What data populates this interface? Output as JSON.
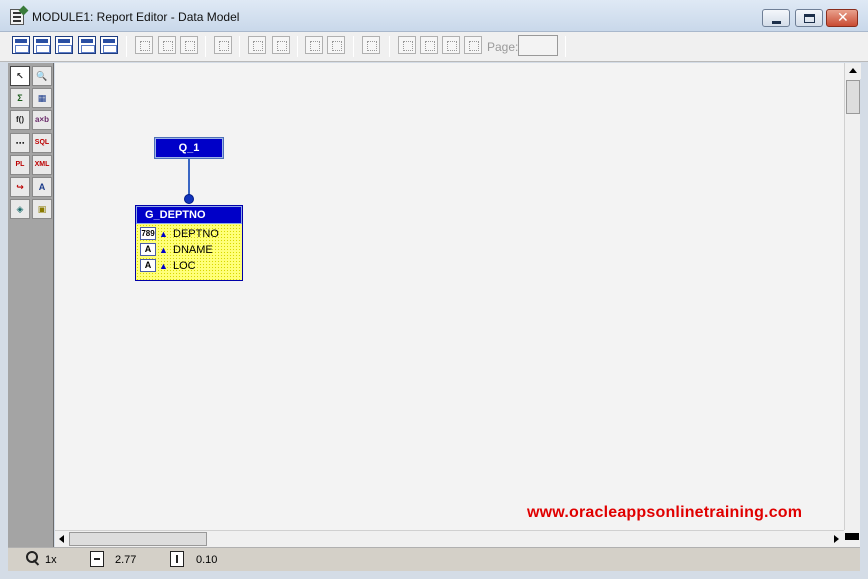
{
  "window": {
    "title": "MODULE1: Report Editor - Data Model",
    "close_glyph": "✕"
  },
  "toolbar": {
    "page_label": "Page:",
    "page_value": ""
  },
  "palette": {
    "tools": [
      {
        "name": "select-tool",
        "glyph": "↖"
      },
      {
        "name": "magnify-tool",
        "glyph": "🔍"
      },
      {
        "name": "summary-column-tool",
        "glyph": "Σ"
      },
      {
        "name": "cross-product-tool",
        "glyph": "▦"
      },
      {
        "name": "formula-column-tool",
        "glyph": "f()"
      },
      {
        "name": "placeholder-column-tool",
        "glyph": "a×b"
      },
      {
        "name": "ref-cursor-query-tool",
        "glyph": "⋯"
      },
      {
        "name": "sql-query-tool",
        "glyph": "SQL"
      },
      {
        "name": "plsql-tool",
        "glyph": "PL"
      },
      {
        "name": "xml-query-tool",
        "glyph": "XML"
      },
      {
        "name": "data-link-tool",
        "glyph": "↪"
      },
      {
        "name": "text-query-tool",
        "glyph": "A"
      },
      {
        "name": "jdbc-query-tool",
        "glyph": "◈"
      },
      {
        "name": "express-query-tool",
        "glyph": "▣"
      }
    ]
  },
  "model": {
    "query": {
      "name": "Q_1"
    },
    "group": {
      "name": "G_DEPTNO",
      "columns": [
        {
          "type": "789",
          "name": "DEPTNO"
        },
        {
          "type": "A",
          "name": "DNAME"
        },
        {
          "type": "A",
          "name": "LOC"
        }
      ]
    },
    "column_arrow": "▲"
  },
  "watermark": "www.oracleappsonlinetraining.com",
  "status": {
    "zoom": "1x",
    "horizontal_position": "2.77",
    "vertical_position": "0.10"
  }
}
